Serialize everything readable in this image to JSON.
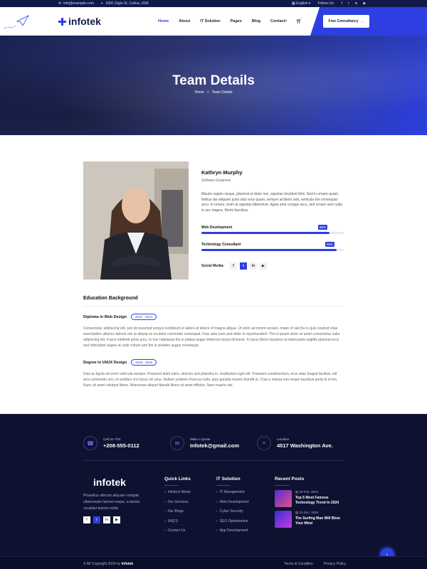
{
  "topbar": {
    "email": "info@example.com",
    "address": "6391 Elgin St. Celina, USA",
    "language": "English",
    "follow_label": "Follow Us:",
    "social_icons": [
      "facebook-icon",
      "twitter-icon",
      "linkedin-icon",
      "youtube-icon"
    ]
  },
  "header": {
    "logo": "infotek",
    "nav": [
      "Home",
      "About",
      "IT Solution",
      "Pages",
      "Blog",
      "Contact"
    ],
    "active_nav": "Home",
    "cta_label": "Free Consultancy"
  },
  "hero": {
    "title": "Team Details",
    "breadcrumb": [
      "Home",
      "Team Details"
    ]
  },
  "profile": {
    "name": "Kathryn Murphy",
    "role": "Software Engineer",
    "bio": "Mauris sapien neque, placerat ut dolor nec, egestas tincidunt felis. Sed in ornare quam, finibus dui aliquam justo duis eros quam, semper at libero sed, vehicula the consequat arcu. In ornare, enim at egestas bibendum, ligula ante congue arcu, sed ornare sem nulla is nec magna. Morbi faucibus.",
    "skills": [
      {
        "label": "Web Development",
        "value": 90,
        "value_text": "90%"
      },
      {
        "label": "Technology Consultant",
        "value": 95,
        "value_text": "95%"
      }
    ],
    "social_label": "Social Media:",
    "social_icons": [
      "f",
      "t",
      "in",
      "yt"
    ]
  },
  "education": {
    "title": "Education Background",
    "degrees": [
      {
        "title": "Diploma in Web Design",
        "years": "2012 - 2014",
        "text": "Consectetur adipiscing elit, sed do eiusmod tempor incididunt ut labore et dolore of magna aliqua. Ut enim ad minim veniam, made of owl the is quis nostrud vitae exercitation ullamco laboris nisi ut aliquip ex ea dolor commodo consequat. Duis aute irure and dolor in reprehenderit. The is ipsum dolor sit amet consectetur nulla adipiscing elit. Fusce eleifend porta arcu. In hac habitasse the is platea augue thelorem turpoi dictumst. In lacus libero faucibus at malesuada sagittis placerat eros sed istincidunt augue ac ante rutrum sed the is sodales augue consequat."
      },
      {
        "title": "Degree in UI/UX Design",
        "years": "2015 - 2016",
        "text": "Duis ac ligula vel enim vehicula semper. Praesent diam enim, ultricies sed pharetra in, vestibulum eget elit. Praesent condimentum, eros vitae feugiat facilisis, elit arcu commodo orci, et sodales orci lacus vel urna. Nullam sodales rhoncus nulla, quis gravida mauris blandit ut. Cras a massa non neque faucibus porta id et leo. Nunc sit amet volutpat libero. Maecenas aliquet blandit libero sit amet efficitur. Nam mauris nisi."
      }
    ]
  },
  "footer": {
    "contacts": [
      {
        "label": "Call Us 7/24",
        "value": "+208-555-0112",
        "icon": "phone-icon"
      },
      {
        "label": "Make A Quote",
        "value": "Infotek@gmail.com",
        "icon": "mail-icon"
      },
      {
        "label": "Location",
        "value": "4517 Washington Ave.",
        "icon": "location-icon"
      }
    ],
    "logo": "infotek",
    "description": "Phasellus ultricies aliquam volutpat ullamcorper laoreet neque, a lacinia curabitur lacinia mollis",
    "quick_links_title": "Quick Links",
    "quick_links": [
      "Infotech About",
      "Our Services",
      "Our Blogs",
      "FAQ'S",
      "Contact Us"
    ],
    "it_solution_title": "IT Solution",
    "it_solution": [
      "IT Management",
      "Web Development",
      "Cyber Security",
      "SEO Optimization",
      "App Development"
    ],
    "recent_posts_title": "Recent Posts",
    "recent_posts": [
      {
        "date": "20 Feb, 2024",
        "title": "Top 5 Most Famous Technology Trend In 2024"
      },
      {
        "date": "15 Dec, 2024",
        "title": "The Surfing Man Will Blow Your Mind"
      }
    ],
    "copyright_prefix": "© All Copyright 2024 by",
    "copyright_brand": "Infotek",
    "legal": [
      "Terms & Condition",
      "Privacy Policy"
    ]
  },
  "colors": {
    "accent": "#2d3fe0",
    "dark": "#0e1130",
    "topbar": "#0f1a4a"
  }
}
